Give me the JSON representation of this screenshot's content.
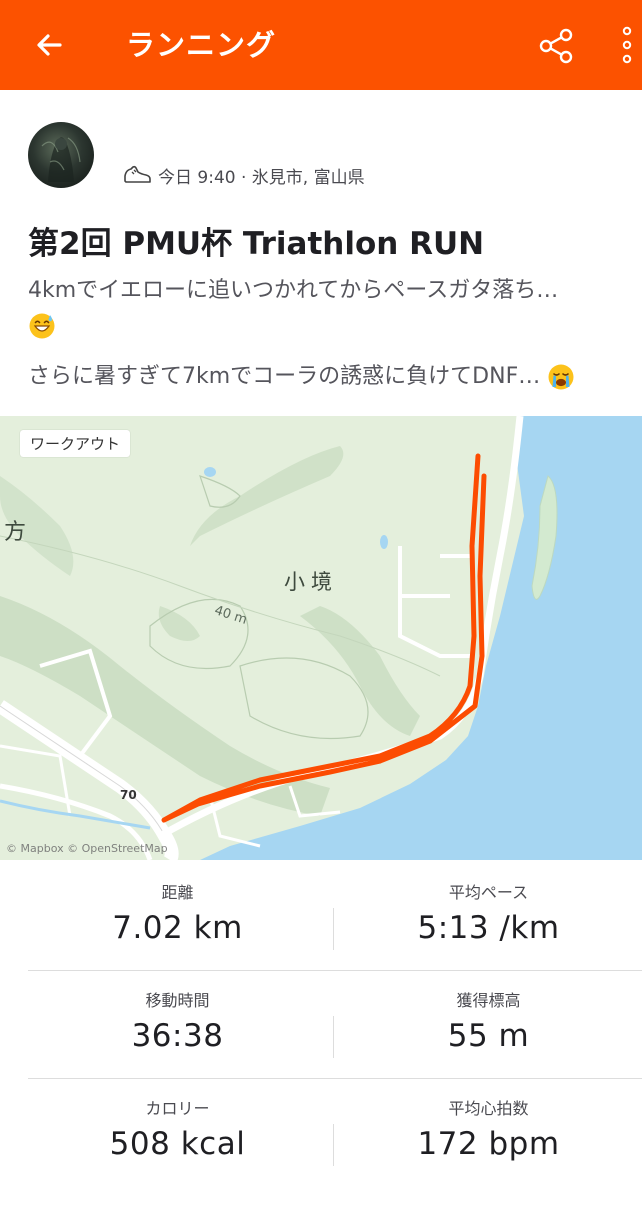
{
  "theme": {
    "accent": "#fc5200",
    "route_color": "#fc4c02",
    "water_color": "#a6d6f2"
  },
  "appbar": {
    "title": "ランニング",
    "back_icon": "back-arrow-icon",
    "share_icon": "share-icon",
    "more_icon": "more-vertical-icon"
  },
  "activity": {
    "sport_icon": "shoe-icon",
    "meta": "今日 9:40 · 氷見市, 富山県",
    "title": "第2回 PMU杯 Triathlon RUN",
    "description_line1": "4kmでイエローに追いつかれてからペースガタ落ち…",
    "description_emoji1": "😅",
    "description_line2": "さらに暑すぎて7kmでコーラの誘惑に負けてDNF…",
    "description_emoji2": "😭"
  },
  "map": {
    "chip": "ワークアウト",
    "place_label": "小境",
    "place_label_partial": "方",
    "elevation_label": "40 m",
    "road_number": "70",
    "attribution": "© Mapbox © OpenStreetMap"
  },
  "stats": [
    {
      "label": "距離",
      "value": "7.02 km"
    },
    {
      "label": "平均ペース",
      "value": "5:13 /km"
    },
    {
      "label": "移動時間",
      "value": "36:38"
    },
    {
      "label": "獲得標高",
      "value": "55 m"
    },
    {
      "label": "カロリー",
      "value": "508 kcal"
    },
    {
      "label": "平均心拍数",
      "value": "172 bpm"
    }
  ]
}
